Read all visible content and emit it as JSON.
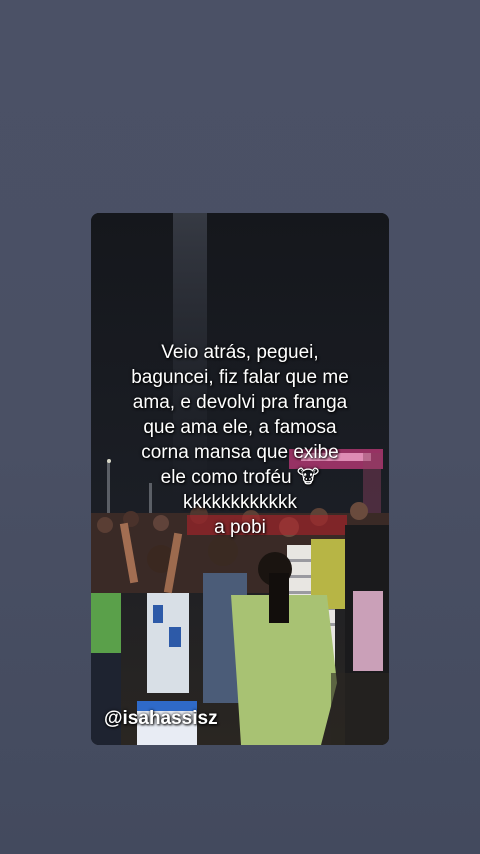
{
  "story": {
    "caption_lines": [
      "Veio atrás, peguei,",
      "baguncei, fiz falar que me",
      "ama, e devolvi pra franga",
      "que ama ele, a famosa",
      "corna mansa que exibe",
      "ele como troféu 🐮",
      "kkkkkkkkkkkk",
      "a pobi"
    ],
    "username": "@isahassisz"
  },
  "colors": {
    "background": "#4a5064",
    "caption_text": "#ffffff"
  }
}
